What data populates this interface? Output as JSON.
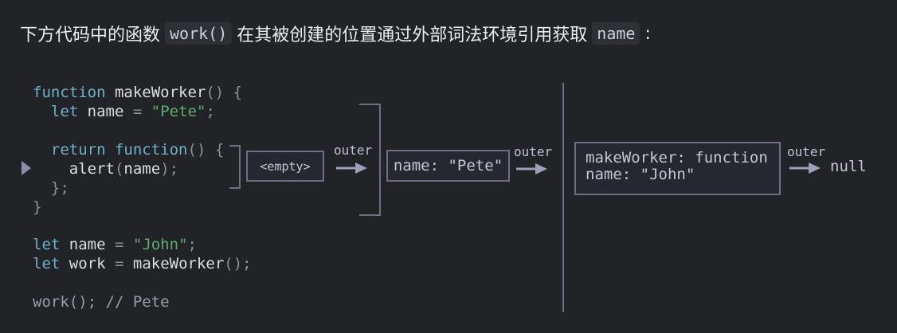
{
  "heading": {
    "text_before": "下方代码中的函数",
    "code_1": "work()",
    "text_middle": "在其被创建的位置通过外部词法环境引用获取",
    "code_2": "name",
    "text_after": ":"
  },
  "code": {
    "kw_function": "function",
    "kw_let": "let",
    "kw_return": "return",
    "fn_makeWorker": "makeWorker",
    "var_name": "name",
    "var_work": "work",
    "str_pete": "\"Pete\"",
    "str_john": "\"John\"",
    "call_alert": "alert",
    "work_call": "work",
    "comment": "// Pete"
  },
  "envs": {
    "empty_label": "<empty>",
    "inner_label": "name: \"Pete\"",
    "global_line1": "makeWorker: function",
    "global_line2": "name: \"John\"",
    "outer_label": "outer",
    "null_label": "null"
  },
  "colors": {
    "background": "#222327",
    "keyword": "#6fb0c9",
    "string": "#5eaa6f",
    "box_border": "#6d6f84"
  }
}
